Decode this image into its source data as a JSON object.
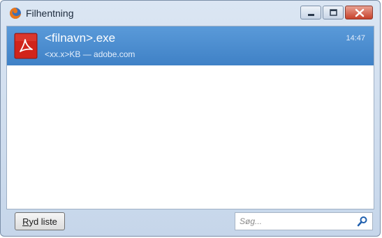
{
  "window": {
    "title": "Filhentning",
    "app_icon": "firefox-icon",
    "controls": [
      "minimize-icon",
      "maximize-icon",
      "close-icon"
    ]
  },
  "downloads": [
    {
      "icon": "adobe-file-icon",
      "filename": "<filnavn>.exe",
      "meta": "<xx.x>KB — adobe.com",
      "time": "14:47",
      "selected": true
    }
  ],
  "footer": {
    "clear_button": {
      "label_accel": "R",
      "label_rest": "yd liste"
    },
    "search": {
      "placeholder": "Søg...",
      "value": "",
      "icon": "search-icon"
    }
  },
  "colors": {
    "selection": "#4b8ed1",
    "titlebar": "#c6d6ea",
    "close_button": "#c7412a",
    "adobe_red": "#d1241b"
  }
}
